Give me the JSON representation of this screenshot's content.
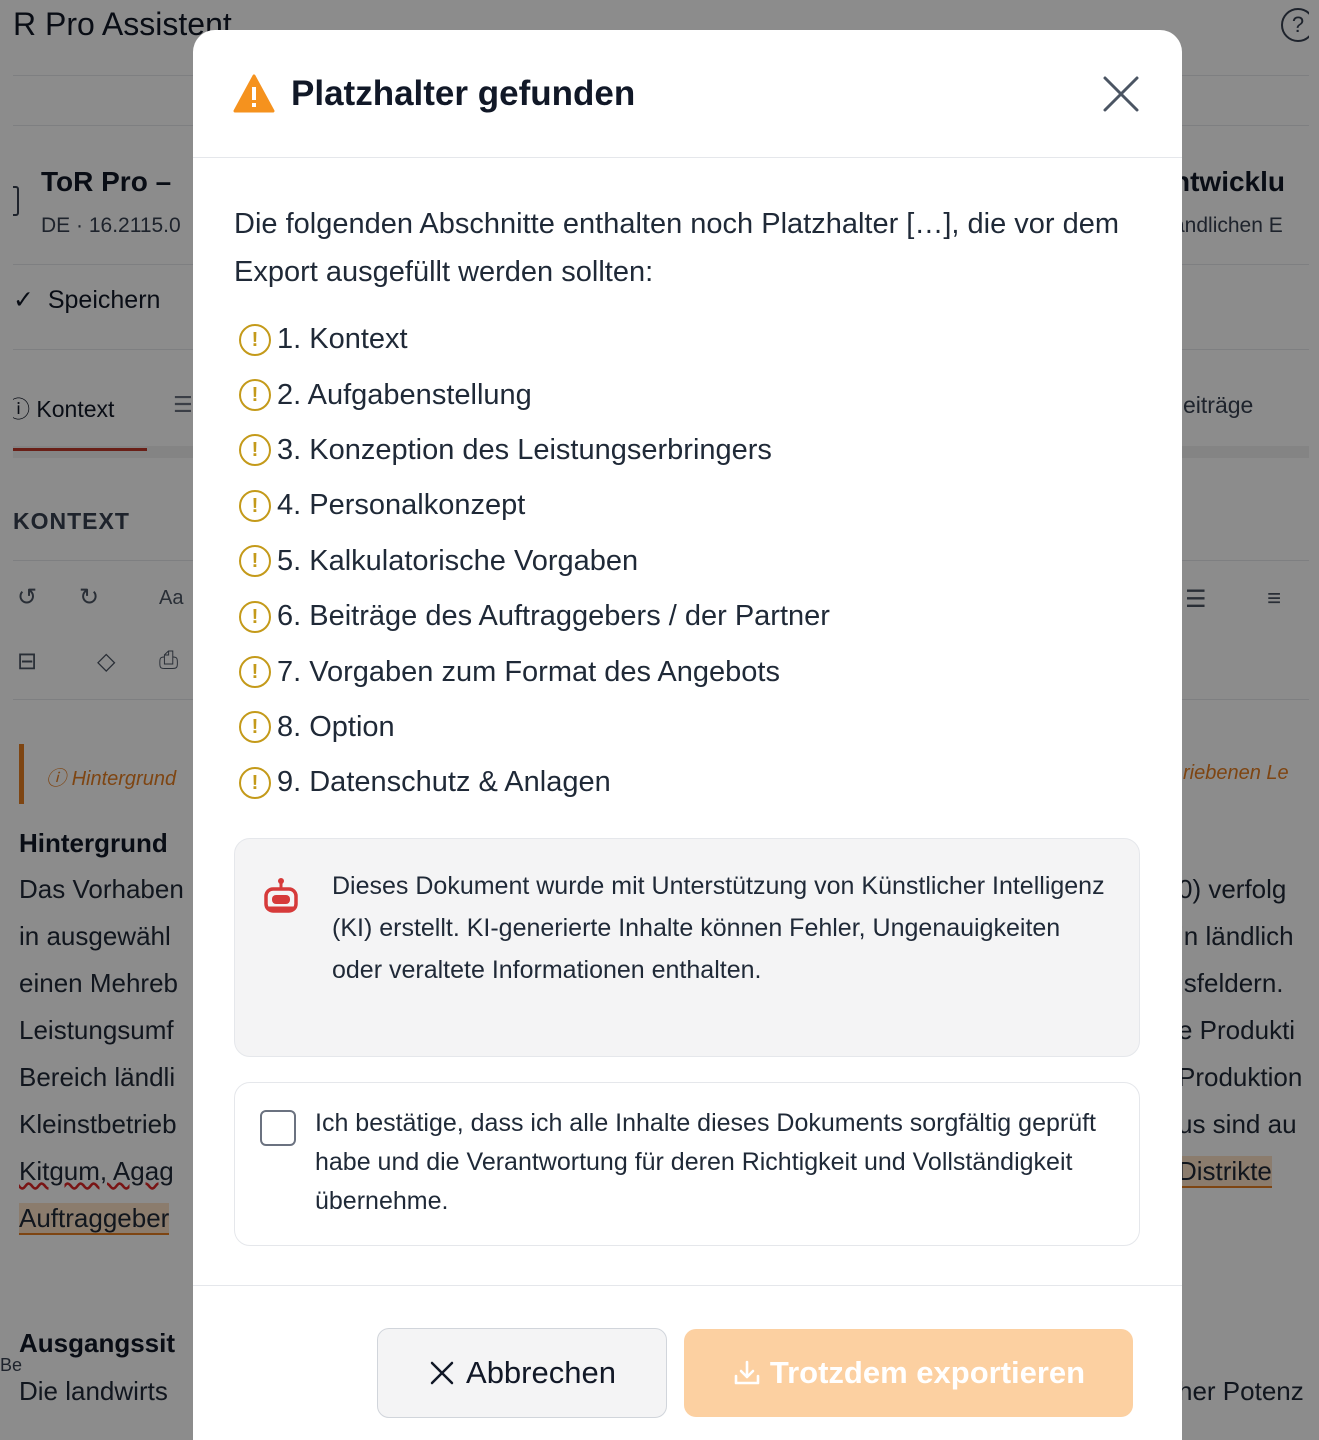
{
  "app": {
    "title": "R Pro Assistent",
    "help_icon": "?",
    "doc_title_left": "ToR Pro – ",
    "doc_title_right": "ntwicklu",
    "doc_meta_left": "DE · 16.2115.0",
    "doc_meta_right": "ändlichen E",
    "save_label": "Speichern",
    "tab_context": "Kontext",
    "tab_right": "eiträge",
    "section_label": "KONTEXT",
    "callout_left": "Hintergrund",
    "callout_right": "riebenen Le",
    "heading_1": "Hintergrund",
    "body_left": [
      "Das Vorhaben",
      "in ausgewähl",
      "einen Mehreb",
      "Leistungsumf",
      "Bereich ländli",
      "Kleinstbetrieb"
    ],
    "body_left_squiggle": "Kitgum, Agag",
    "body_left_highlight": "Auftraggeber",
    "body_right": [
      "0) verfolg",
      "in ländlich",
      "jsfeldern.",
      "e Produkti",
      "Produktion",
      "us sind au"
    ],
    "body_right_highlight": "Distrikte",
    "heading_2": "Ausgangssit",
    "body_left_2": "Die landwirts",
    "body_right_2": "her Potenz",
    "be_text": "Be"
  },
  "modal": {
    "title": "Platzhalter gefunden",
    "intro": "Die folgenden Abschnitte enthalten noch Platzhalter […], die vor dem Export ausgefüllt werden sollten:",
    "placeholder_icon": "!",
    "sections": [
      "1. Kontext",
      "2. Aufgabenstellung",
      "3. Konzeption des Leistungserbringers",
      "4. Personalkonzept",
      "5. Kalkulatorische Vorgaben",
      "6. Beiträge des Auftraggebers / der Partner",
      "7. Vorgaben zum Format des Angebots",
      "8. Option",
      "9. Datenschutz & Anlagen"
    ],
    "ai_notice": "Dieses Dokument wurde mit Unterstützung von Künstlicher Intelligenz (KI) erstellt. KI-generierte Inhalte können Fehler, Ungenauigkeiten oder veraltete Informationen enthalten.",
    "confirm_text": "Ich bestätige, dass ich alle Inhalte dieses Dokuments sorgfältig geprüft habe und die Verantwortung für deren Richtigkeit und Vollständigkeit übernehme.",
    "confirm_checked": false,
    "cancel_label": "Abbrechen",
    "export_label": "Trotzdem exportieren"
  },
  "colors": {
    "warning": "#f5921e",
    "placeholder_icon": "#c49a1a",
    "export_disabled": "#fcd0a1",
    "robot": "#d63a3a",
    "active_tab": "#c0392b"
  },
  "icons": {
    "title": "warning-triangle-icon",
    "close": "close-icon",
    "placeholder": "exclamation-circle-icon",
    "ai": "robot-icon",
    "cancel": "x-icon",
    "export": "download-icon"
  }
}
